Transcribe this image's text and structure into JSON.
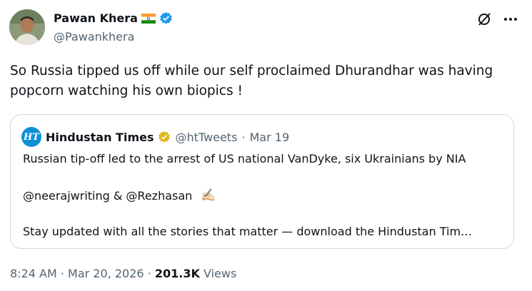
{
  "author": {
    "name": "Pawan Khera",
    "handle": "@Pawankhera",
    "flag_icon": "india-flag-icon",
    "verified_icon": "verified-badge-icon"
  },
  "header_actions": {
    "grok_icon": "grok-icon",
    "more_icon": "more-icon"
  },
  "tweet": {
    "text": "So Russia tipped us off while our self proclaimed Dhurandhar was having popcorn watching his own biopics !"
  },
  "quote": {
    "logo_text": "HT",
    "name": "Hindustan Times",
    "handle": "@htTweets",
    "separator": "·",
    "date": "Mar 19",
    "line1": "Russian tip-off led to the arrest of US national VanDyke, six Ukrainians by NIA",
    "line2": "@neerajwriting & @Rezhasan",
    "line3": "Stay updated with all the stories that matter — download the Hindustan Tim…"
  },
  "footer": {
    "time": "8:24 AM",
    "sep": "·",
    "date": "Mar 20, 2026",
    "views_count": "201.3K",
    "views_label": "Views"
  },
  "colors": {
    "verified_blue": "#1d9bf0",
    "gold_badge": "#e2b719",
    "muted": "#536471",
    "border": "#cfd9de"
  }
}
